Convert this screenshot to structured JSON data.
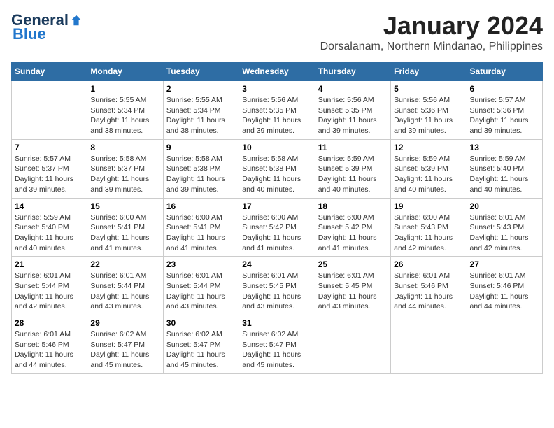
{
  "logo": {
    "general": "General",
    "blue": "Blue"
  },
  "title": "January 2024",
  "subtitle": "Dorsalanam, Northern Mindanao, Philippines",
  "weekdays": [
    "Sunday",
    "Monday",
    "Tuesday",
    "Wednesday",
    "Thursday",
    "Friday",
    "Saturday"
  ],
  "weeks": [
    [
      {
        "day": "",
        "info": ""
      },
      {
        "day": "1",
        "info": "Sunrise: 5:55 AM\nSunset: 5:34 PM\nDaylight: 11 hours\nand 38 minutes."
      },
      {
        "day": "2",
        "info": "Sunrise: 5:55 AM\nSunset: 5:34 PM\nDaylight: 11 hours\nand 38 minutes."
      },
      {
        "day": "3",
        "info": "Sunrise: 5:56 AM\nSunset: 5:35 PM\nDaylight: 11 hours\nand 39 minutes."
      },
      {
        "day": "4",
        "info": "Sunrise: 5:56 AM\nSunset: 5:35 PM\nDaylight: 11 hours\nand 39 minutes."
      },
      {
        "day": "5",
        "info": "Sunrise: 5:56 AM\nSunset: 5:36 PM\nDaylight: 11 hours\nand 39 minutes."
      },
      {
        "day": "6",
        "info": "Sunrise: 5:57 AM\nSunset: 5:36 PM\nDaylight: 11 hours\nand 39 minutes."
      }
    ],
    [
      {
        "day": "7",
        "info": "Sunrise: 5:57 AM\nSunset: 5:37 PM\nDaylight: 11 hours\nand 39 minutes."
      },
      {
        "day": "8",
        "info": "Sunrise: 5:58 AM\nSunset: 5:37 PM\nDaylight: 11 hours\nand 39 minutes."
      },
      {
        "day": "9",
        "info": "Sunrise: 5:58 AM\nSunset: 5:38 PM\nDaylight: 11 hours\nand 39 minutes."
      },
      {
        "day": "10",
        "info": "Sunrise: 5:58 AM\nSunset: 5:38 PM\nDaylight: 11 hours\nand 40 minutes."
      },
      {
        "day": "11",
        "info": "Sunrise: 5:59 AM\nSunset: 5:39 PM\nDaylight: 11 hours\nand 40 minutes."
      },
      {
        "day": "12",
        "info": "Sunrise: 5:59 AM\nSunset: 5:39 PM\nDaylight: 11 hours\nand 40 minutes."
      },
      {
        "day": "13",
        "info": "Sunrise: 5:59 AM\nSunset: 5:40 PM\nDaylight: 11 hours\nand 40 minutes."
      }
    ],
    [
      {
        "day": "14",
        "info": "Sunrise: 5:59 AM\nSunset: 5:40 PM\nDaylight: 11 hours\nand 40 minutes."
      },
      {
        "day": "15",
        "info": "Sunrise: 6:00 AM\nSunset: 5:41 PM\nDaylight: 11 hours\nand 41 minutes."
      },
      {
        "day": "16",
        "info": "Sunrise: 6:00 AM\nSunset: 5:41 PM\nDaylight: 11 hours\nand 41 minutes."
      },
      {
        "day": "17",
        "info": "Sunrise: 6:00 AM\nSunset: 5:42 PM\nDaylight: 11 hours\nand 41 minutes."
      },
      {
        "day": "18",
        "info": "Sunrise: 6:00 AM\nSunset: 5:42 PM\nDaylight: 11 hours\nand 41 minutes."
      },
      {
        "day": "19",
        "info": "Sunrise: 6:00 AM\nSunset: 5:43 PM\nDaylight: 11 hours\nand 42 minutes."
      },
      {
        "day": "20",
        "info": "Sunrise: 6:01 AM\nSunset: 5:43 PM\nDaylight: 11 hours\nand 42 minutes."
      }
    ],
    [
      {
        "day": "21",
        "info": "Sunrise: 6:01 AM\nSunset: 5:44 PM\nDaylight: 11 hours\nand 42 minutes."
      },
      {
        "day": "22",
        "info": "Sunrise: 6:01 AM\nSunset: 5:44 PM\nDaylight: 11 hours\nand 43 minutes."
      },
      {
        "day": "23",
        "info": "Sunrise: 6:01 AM\nSunset: 5:44 PM\nDaylight: 11 hours\nand 43 minutes."
      },
      {
        "day": "24",
        "info": "Sunrise: 6:01 AM\nSunset: 5:45 PM\nDaylight: 11 hours\nand 43 minutes."
      },
      {
        "day": "25",
        "info": "Sunrise: 6:01 AM\nSunset: 5:45 PM\nDaylight: 11 hours\nand 43 minutes."
      },
      {
        "day": "26",
        "info": "Sunrise: 6:01 AM\nSunset: 5:46 PM\nDaylight: 11 hours\nand 44 minutes."
      },
      {
        "day": "27",
        "info": "Sunrise: 6:01 AM\nSunset: 5:46 PM\nDaylight: 11 hours\nand 44 minutes."
      }
    ],
    [
      {
        "day": "28",
        "info": "Sunrise: 6:01 AM\nSunset: 5:46 PM\nDaylight: 11 hours\nand 44 minutes."
      },
      {
        "day": "29",
        "info": "Sunrise: 6:02 AM\nSunset: 5:47 PM\nDaylight: 11 hours\nand 45 minutes."
      },
      {
        "day": "30",
        "info": "Sunrise: 6:02 AM\nSunset: 5:47 PM\nDaylight: 11 hours\nand 45 minutes."
      },
      {
        "day": "31",
        "info": "Sunrise: 6:02 AM\nSunset: 5:47 PM\nDaylight: 11 hours\nand 45 minutes."
      },
      {
        "day": "",
        "info": ""
      },
      {
        "day": "",
        "info": ""
      },
      {
        "day": "",
        "info": ""
      }
    ]
  ]
}
